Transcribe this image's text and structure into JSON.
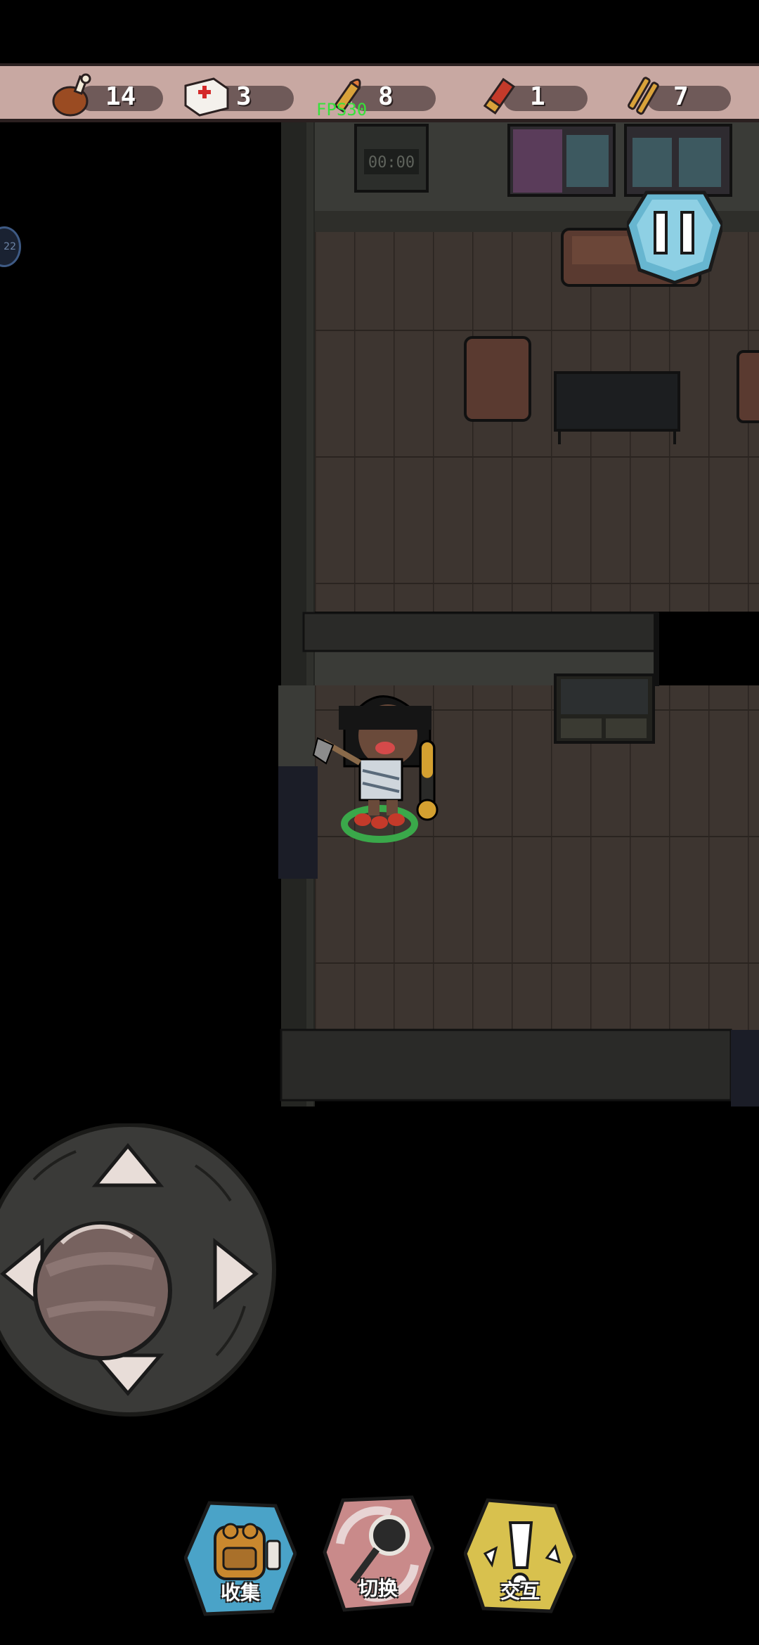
{
  "hud": {
    "resources": [
      {
        "name": "food",
        "icon": "drumstick-icon",
        "count": "14"
      },
      {
        "name": "medkit",
        "icon": "medkit-icon",
        "count": "3"
      },
      {
        "name": "bullets",
        "icon": "bullet-icon",
        "count": "8"
      },
      {
        "name": "shells",
        "icon": "shotgun-shell-icon",
        "count": "1"
      },
      {
        "name": "rifle-ammo",
        "icon": "rifle-ammo-icon",
        "count": "7"
      }
    ],
    "fps": "FPS30",
    "side_badge": "22",
    "clock": "00:00"
  },
  "actions": [
    {
      "label": "收集",
      "icon": "backpack-icon",
      "color": "#4aa3c8"
    },
    {
      "label": "切换",
      "icon": "switch-weapon-icon",
      "color": "#c98a8a"
    },
    {
      "label": "交互",
      "icon": "exclamation-icon",
      "color": "#d8c14e"
    }
  ],
  "player": {
    "health_fraction": 0.55
  },
  "colors": {
    "topbar": "#c8a8a2",
    "floor": "#3d3530",
    "wall": "#2a2a28",
    "accent_green": "#36e23a"
  }
}
